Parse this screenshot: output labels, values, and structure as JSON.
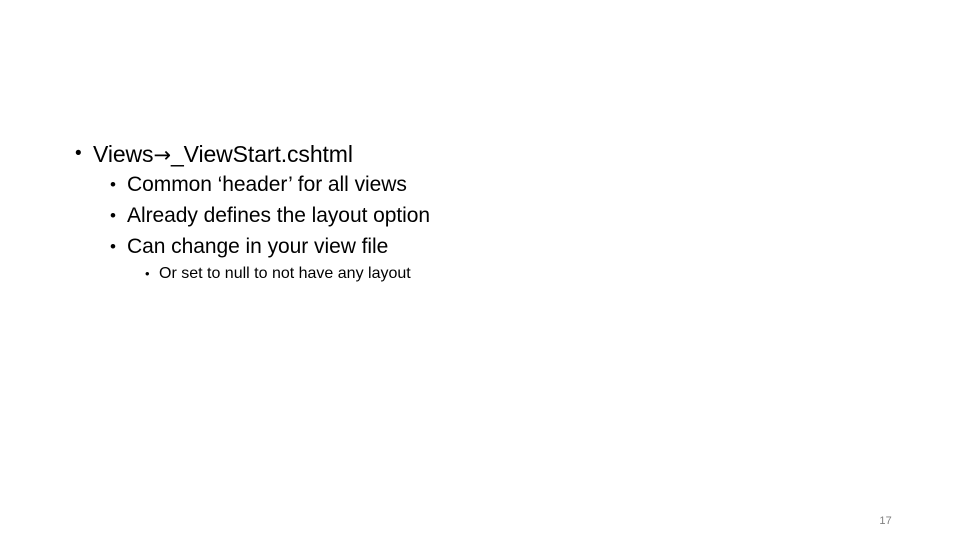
{
  "slide": {
    "background_color": "#ffffff",
    "text_color": "#000000",
    "bullet_glyph": "•",
    "outline": [
      {
        "level": 1,
        "bullet": "•",
        "text_before_arrow": "Views",
        "arrow": "→",
        "text_after_arrow": "_ViewStart.cshtml",
        "full_text": "Views→_ViewStart.cshtml"
      },
      {
        "level": 2,
        "bullet": "•",
        "full_text": "Common ‘header’ for all views"
      },
      {
        "level": 2,
        "bullet": "•",
        "full_text": "Already defines the layout option"
      },
      {
        "level": 2,
        "bullet": "•",
        "full_text": "Can change in your view file"
      },
      {
        "level": 3,
        "bullet": "•",
        "full_text": "Or set to null to not have any layout"
      }
    ],
    "slide_number": "17",
    "slide_number_color": "#808080"
  }
}
